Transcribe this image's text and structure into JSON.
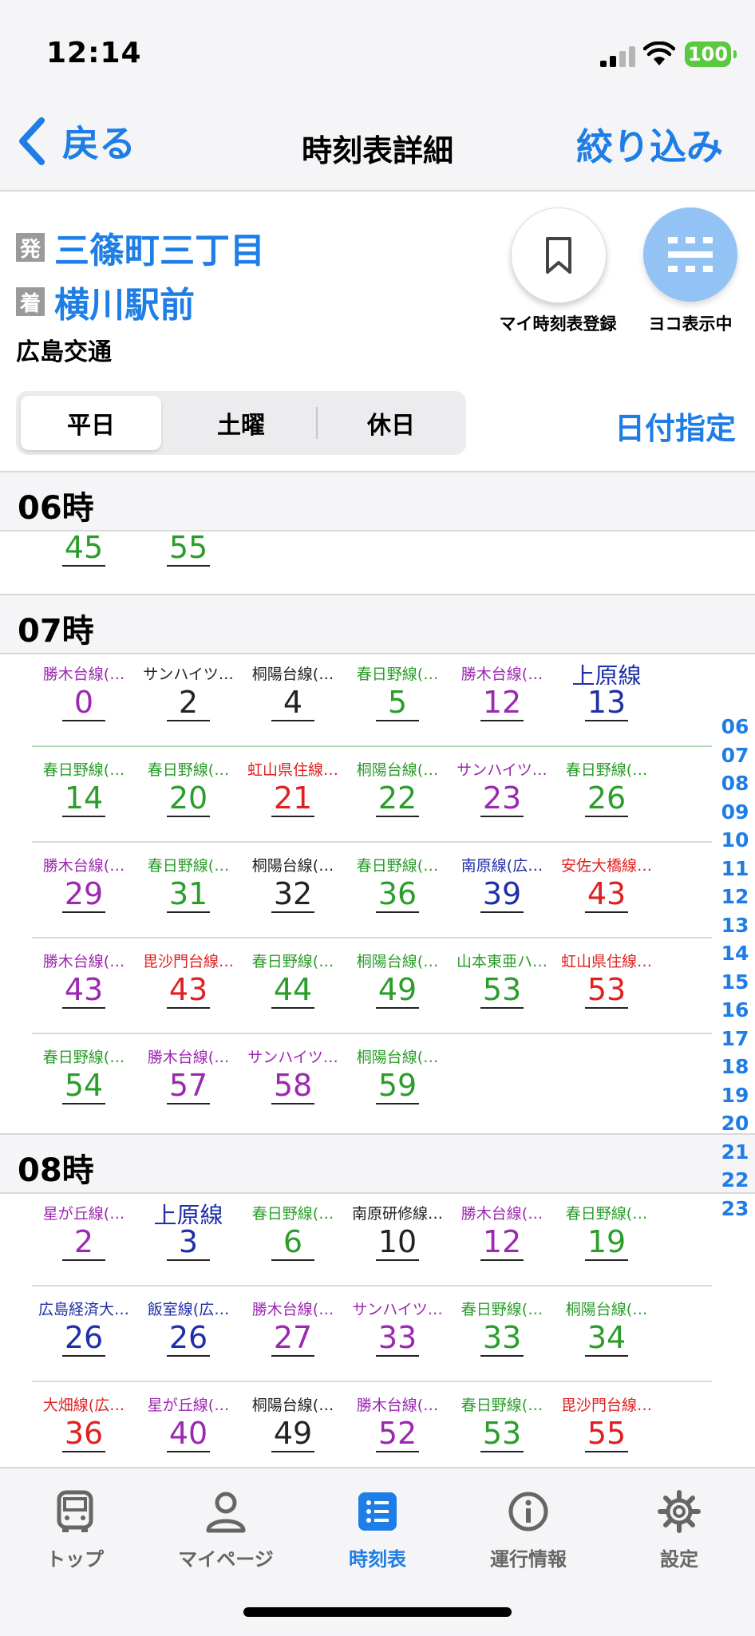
{
  "status": {
    "time": "12:14",
    "battery": "100"
  },
  "nav": {
    "back": "戻る",
    "title": "時刻表詳細",
    "filter": "絞り込み"
  },
  "stops": {
    "from_tag": "発",
    "from": "三篠町三丁目",
    "to_tag": "着",
    "to": "横川駅前",
    "company": "広島交通"
  },
  "actions": {
    "bookmark_label": "マイ時刻表登録",
    "yoko_label": "ヨコ表示中"
  },
  "segments": [
    "平日",
    "土曜",
    "休日"
  ],
  "date_button": "日付指定",
  "hours": {
    "h06": {
      "label": "06時",
      "rows": [
        [
          {
            "route": "",
            "min": "45",
            "color": "#2a9d2a"
          },
          {
            "route": "",
            "min": "55",
            "color": "#2a9d2a"
          }
        ]
      ]
    },
    "h07": {
      "label": "07時",
      "rows": [
        [
          {
            "route": "勝木台線(…",
            "min": "0",
            "color": "#9c27b0"
          },
          {
            "route": "サンハイツ…",
            "min": "2",
            "color": "#222222"
          },
          {
            "route": "桐陽台線(…",
            "min": "4",
            "color": "#222222"
          },
          {
            "route": "春日野線(…",
            "min": "5",
            "color": "#2a9d2a"
          },
          {
            "route": "勝木台線(…",
            "min": "12",
            "color": "#9c27b0"
          },
          {
            "route": "上原線",
            "min": "13",
            "color": "#1f2fa8",
            "big": true
          }
        ],
        [
          {
            "route": "春日野線(…",
            "min": "14",
            "color": "#2a9d2a"
          },
          {
            "route": "春日野線(…",
            "min": "20",
            "color": "#2a9d2a"
          },
          {
            "route": "虹山県住線…",
            "min": "21",
            "color": "#e02020"
          },
          {
            "route": "桐陽台線(…",
            "min": "22",
            "color": "#2a9d2a"
          },
          {
            "route": "サンハイツ…",
            "min": "23",
            "color": "#9c27b0"
          },
          {
            "route": "春日野線(…",
            "min": "26",
            "color": "#2a9d2a"
          }
        ],
        [
          {
            "route": "勝木台線(…",
            "min": "29",
            "color": "#9c27b0"
          },
          {
            "route": "春日野線(…",
            "min": "31",
            "color": "#2a9d2a"
          },
          {
            "route": "桐陽台線(…",
            "min": "32",
            "color": "#222222"
          },
          {
            "route": "春日野線(…",
            "min": "36",
            "color": "#2a9d2a"
          },
          {
            "route": "南原線(広…",
            "min": "39",
            "color": "#1f2fa8"
          },
          {
            "route": "安佐大橋線…",
            "min": "43",
            "color": "#e02020"
          }
        ],
        [
          {
            "route": "勝木台線(…",
            "min": "43",
            "color": "#9c27b0"
          },
          {
            "route": "毘沙門台線…",
            "min": "43",
            "color": "#e02020"
          },
          {
            "route": "春日野線(…",
            "min": "44",
            "color": "#2a9d2a"
          },
          {
            "route": "桐陽台線(…",
            "min": "49",
            "color": "#2a9d2a"
          },
          {
            "route": "山本東亜ハ…",
            "min": "53",
            "color": "#2a9d2a"
          },
          {
            "route": "虹山県住線…",
            "min": "53",
            "color": "#e02020"
          }
        ],
        [
          {
            "route": "春日野線(…",
            "min": "54",
            "color": "#2a9d2a"
          },
          {
            "route": "勝木台線(…",
            "min": "57",
            "color": "#9c27b0"
          },
          {
            "route": "サンハイツ…",
            "min": "58",
            "color": "#9c27b0"
          },
          {
            "route": "桐陽台線(…",
            "min": "59",
            "color": "#2a9d2a"
          }
        ]
      ]
    },
    "h08": {
      "label": "08時",
      "rows": [
        [
          {
            "route": "星が丘線(…",
            "min": "2",
            "color": "#9c27b0"
          },
          {
            "route": "上原線",
            "min": "3",
            "color": "#1f2fa8",
            "big": true
          },
          {
            "route": "春日野線(…",
            "min": "6",
            "color": "#2a9d2a"
          },
          {
            "route": "南原研修線…",
            "min": "10",
            "color": "#222222"
          },
          {
            "route": "勝木台線(…",
            "min": "12",
            "color": "#9c27b0"
          },
          {
            "route": "春日野線(…",
            "min": "19",
            "color": "#2a9d2a"
          }
        ],
        [
          {
            "route": "広島経済大…",
            "min": "26",
            "color": "#1f2fa8"
          },
          {
            "route": "飯室線(広…",
            "min": "26",
            "color": "#1f2fa8"
          },
          {
            "route": "勝木台線(…",
            "min": "27",
            "color": "#9c27b0"
          },
          {
            "route": "サンハイツ…",
            "min": "33",
            "color": "#9c27b0"
          },
          {
            "route": "春日野線(…",
            "min": "33",
            "color": "#2a9d2a"
          },
          {
            "route": "桐陽台線(…",
            "min": "34",
            "color": "#2a9d2a"
          }
        ],
        [
          {
            "route": "大畑線(広…",
            "min": "36",
            "color": "#e02020"
          },
          {
            "route": "星が丘線(…",
            "min": "40",
            "color": "#9c27b0"
          },
          {
            "route": "桐陽台線(…",
            "min": "49",
            "color": "#222222"
          },
          {
            "route": "勝木台線(…",
            "min": "52",
            "color": "#9c27b0"
          },
          {
            "route": "春日野線(…",
            "min": "53",
            "color": "#2a9d2a"
          },
          {
            "route": "毘沙門台線…",
            "min": "55",
            "color": "#e02020"
          }
        ]
      ]
    }
  },
  "hour_index": [
    "06",
    "07",
    "08",
    "09",
    "10",
    "11",
    "12",
    "13",
    "14",
    "15",
    "16",
    "17",
    "18",
    "19",
    "20",
    "21",
    "22",
    "23"
  ],
  "tabs": [
    {
      "label": "トップ",
      "icon": "bus-icon"
    },
    {
      "label": "マイページ",
      "icon": "person-icon"
    },
    {
      "label": "時刻表",
      "icon": "timetable-icon"
    },
    {
      "label": "運行情報",
      "icon": "info-icon"
    },
    {
      "label": "設定",
      "icon": "gear-icon"
    }
  ],
  "colors": {
    "accent": "#1e7ee6"
  }
}
